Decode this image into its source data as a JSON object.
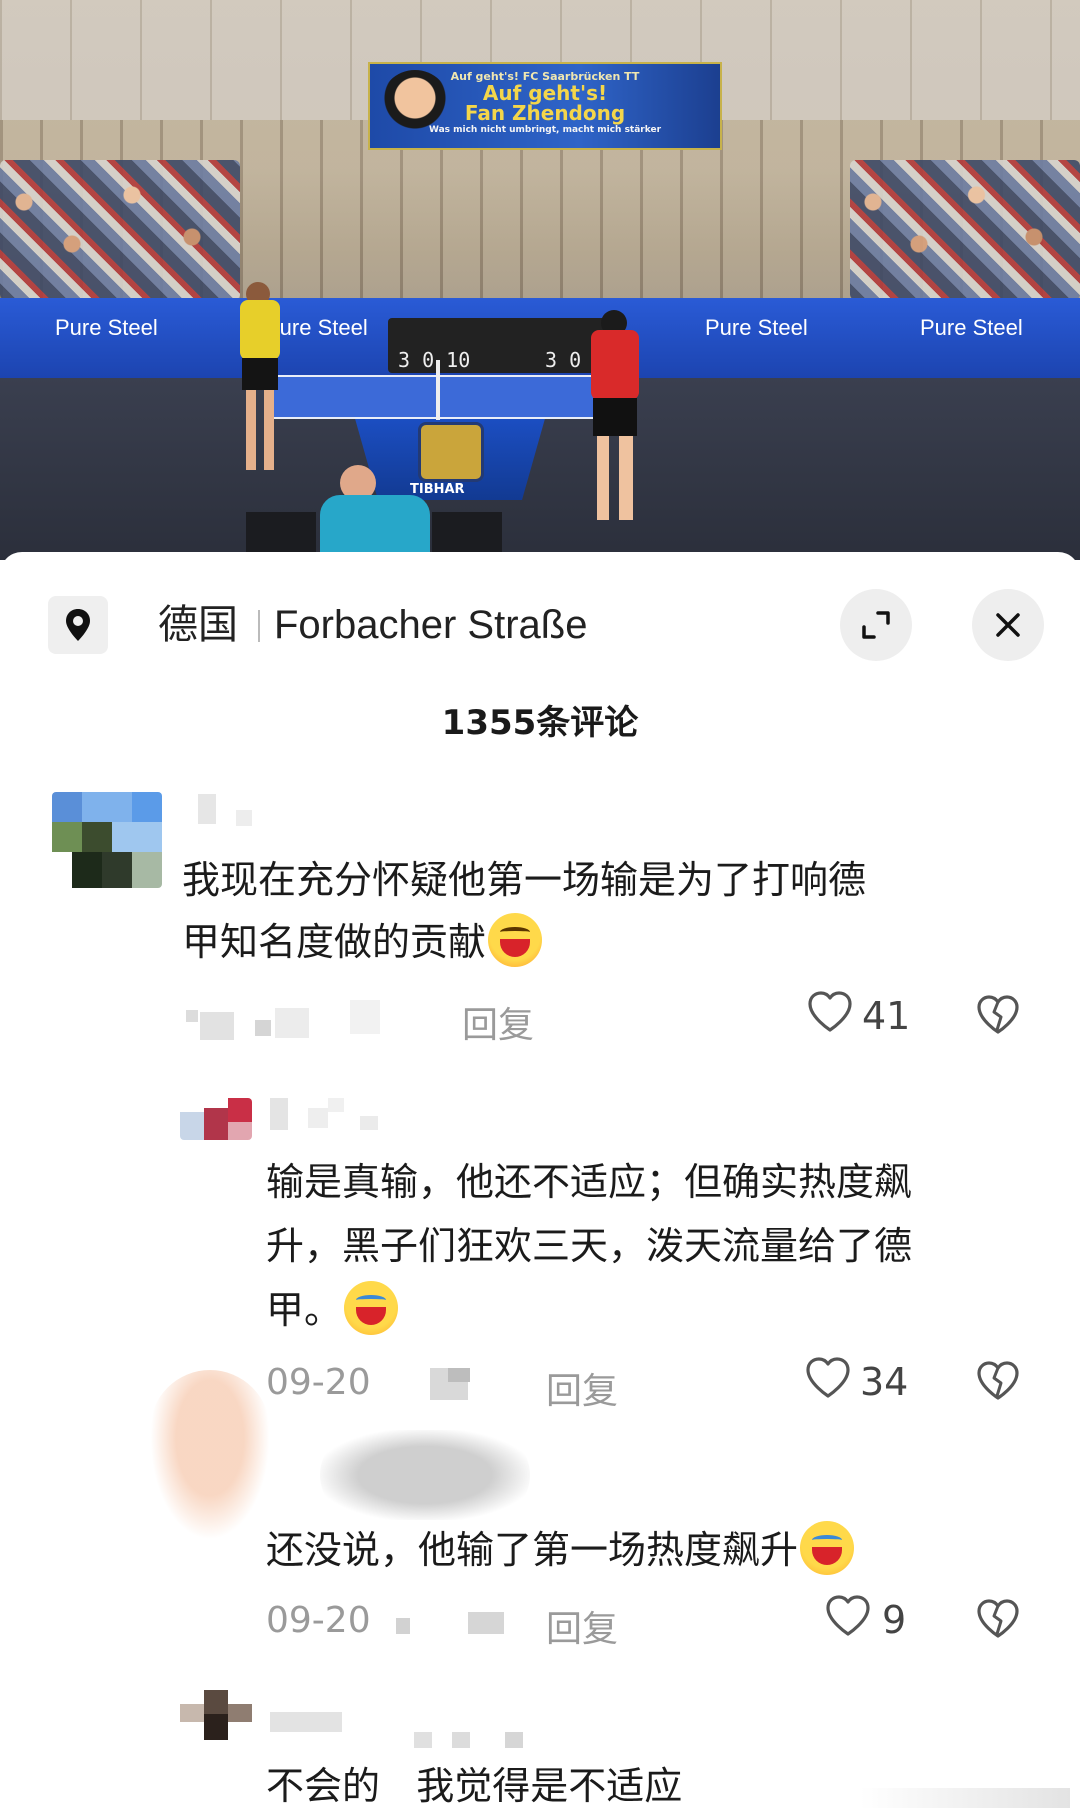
{
  "photo": {
    "banner_line1": "Auf geht's! FC Saarbrücken TT",
    "banner_line2": "Auf geht's!",
    "banner_line3": "Fan Zhendong",
    "banner_line4": "Was mich nicht umbringt, macht mich stärker",
    "sponsor": "Pure Steel",
    "table_brand": "TIBHAR",
    "score_left": "3 0 10",
    "score_right": "3 0"
  },
  "location": {
    "country": "德国",
    "street": "Forbacher Straße"
  },
  "comment_count": "1355条评论",
  "comments": [
    {
      "text_line1": "我现在充分怀疑他第一场输是为了打响德",
      "text_line2": "甲知名度做的贡献",
      "reply_label": "回复",
      "likes": "41"
    },
    {
      "text_line1": "输是真输，他还不适应；但确实热度飙",
      "text_line2": "升，黑子们狂欢三天，泼天流量给了德",
      "text_line3": "甲。",
      "date": "09-20",
      "reply_label": "回复",
      "likes": "34"
    },
    {
      "text_line1": "还没说，他输了第一场热度飙升",
      "date": "09-20",
      "reply_label": "回复",
      "likes": "9"
    },
    {
      "text_line1": "不会的   我觉得是不适应"
    }
  ],
  "colors": {
    "accent_blue": "#2a5bd6",
    "meta_gray": "#9a9a9a",
    "sheet_bg": "#ffffff"
  },
  "icons": [
    "location-pin-icon",
    "expand-icon",
    "close-icon",
    "heart-icon",
    "dislike-heart-icon",
    "emoji-laugh-icon",
    "emoji-cry-laugh-icon"
  ]
}
